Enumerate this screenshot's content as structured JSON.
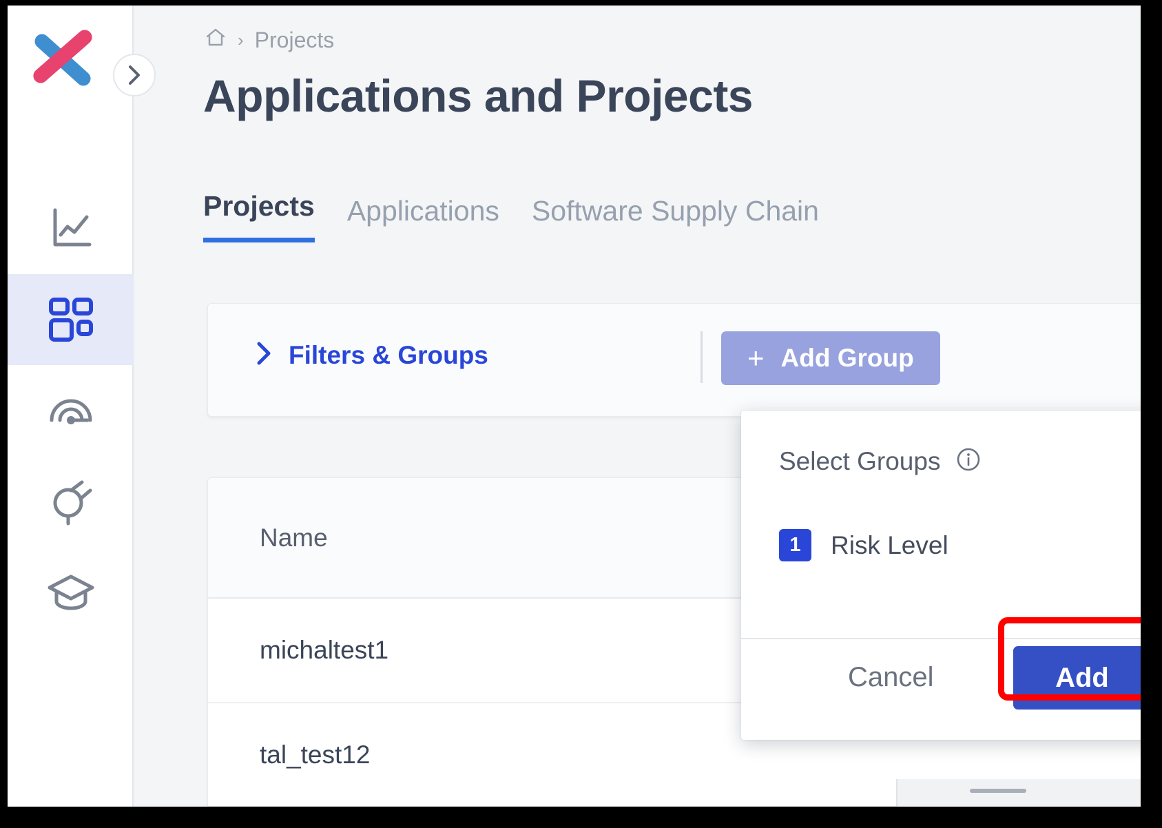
{
  "app": {
    "logo_name": "checkmarx-x-logo",
    "logo_colors": {
      "top": "#e8426f",
      "bottom": "#3f8fd0"
    }
  },
  "sidebar": {
    "toggle_icon": "chevron-right-icon",
    "items": [
      {
        "icon": "analytics-chart-icon",
        "name": "dashboard-analytics",
        "active": false
      },
      {
        "icon": "grid-apps-icon",
        "name": "applications-projects",
        "active": true
      },
      {
        "icon": "gauge-risk-icon",
        "name": "risk-management",
        "active": false
      },
      {
        "icon": "plug-integrations-icon",
        "name": "integrations",
        "active": false
      },
      {
        "icon": "graduation-cap-icon",
        "name": "learning",
        "active": false
      }
    ],
    "active_color": "#2a46d8",
    "active_bg": "#e5e9f8"
  },
  "breadcrumb": {
    "home_icon": "home-icon",
    "separator": "›",
    "items": [
      "Projects"
    ]
  },
  "header": {
    "title": "Applications and Projects"
  },
  "tabs": [
    {
      "label": "Projects",
      "active": true
    },
    {
      "label": "Applications",
      "active": false
    },
    {
      "label": "Software Supply Chain",
      "active": false
    }
  ],
  "filter_bar": {
    "chevron_icon": "chevron-right-icon",
    "filters_label": "Filters & Groups",
    "add_group": {
      "label": "Add Group",
      "plus_icon": "plus-icon",
      "color": "#97a2de"
    }
  },
  "table": {
    "columns": [
      "Name"
    ],
    "rows": [
      {
        "name": "michaltest1"
      },
      {
        "name": "tal_test12"
      }
    ]
  },
  "groups_popup": {
    "title": "Select Groups",
    "info_icon": "info-circle-icon",
    "options": [
      {
        "badge": "1",
        "label": "Risk Level",
        "badge_color": "#2a46d8"
      }
    ],
    "cancel_label": "Cancel",
    "add_label": "Add",
    "add_color": "#3550c5"
  },
  "annotation": {
    "highlight_target": "add-button",
    "highlight_color": "#ff0000"
  }
}
